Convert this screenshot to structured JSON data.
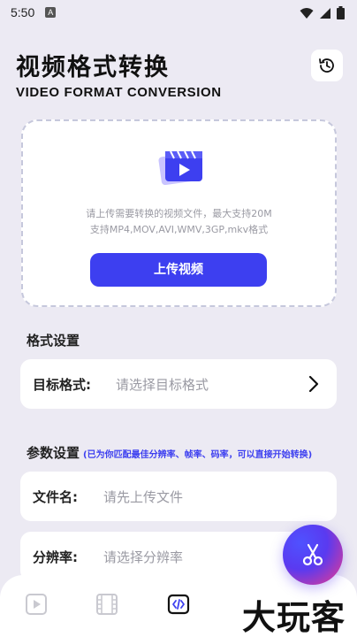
{
  "status": {
    "time": "5:50",
    "notif": "A"
  },
  "header": {
    "title": "视频格式转换",
    "subtitle": "VIDEO FORMAT CONVERSION"
  },
  "upload": {
    "hint_line1": "请上传需要转换的视频文件，最大支持20M",
    "hint_line2": "支持MP4,MOV,AVI,WMV,3GP,mkv格式",
    "button_label": "上传视频"
  },
  "format_section": {
    "title": "格式设置",
    "target_label": "目标格式:",
    "target_placeholder": "请选择目标格式"
  },
  "params_section": {
    "title": "参数设置",
    "note": "(已为你匹配最佳分辨率、帧率、码率，可以直接开始转换)",
    "filename_label": "文件名:",
    "filename_placeholder": "请先上传文件",
    "resolution_label": "分辨率:",
    "resolution_placeholder": "请选择分辨率"
  },
  "watermark": "大玩客",
  "colors": {
    "accent": "#3d3ff0",
    "background": "#eceaf3"
  },
  "icons": {
    "history": "history-clock-icon",
    "upload": "video-clapper-icon",
    "chevron": "chevron-right-icon",
    "fab": "scissors-icon",
    "nav": [
      "play-icon",
      "film-icon",
      "code-icon"
    ]
  }
}
